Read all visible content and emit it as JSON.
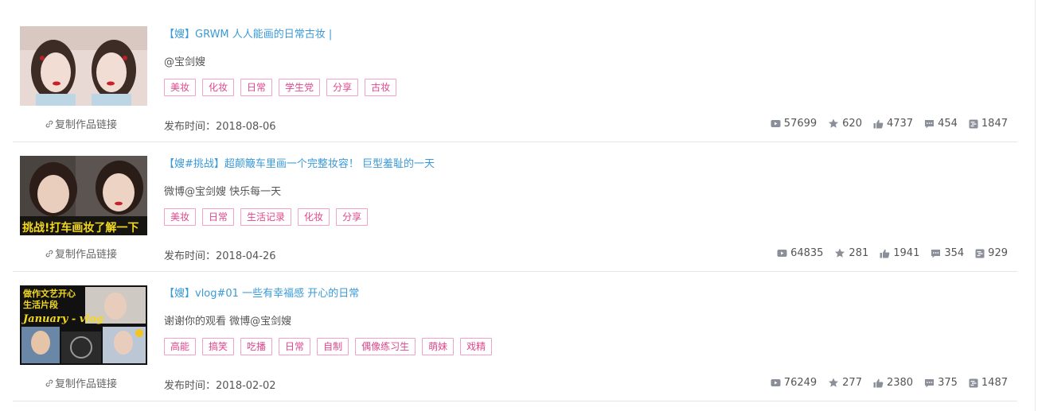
{
  "colors": {
    "title": "#3a9ad9",
    "tag_text": "#e0468c",
    "tag_border": "#f2a3c7",
    "icon": "#8a8f99"
  },
  "copy_link_label": "复制作品链接",
  "date_prefix": "发布时间：",
  "stat_icons": [
    "play-icon",
    "star-icon",
    "thumbs-up-icon",
    "comment-icon",
    "danmaku-icon"
  ],
  "videos": [
    {
      "title": "【嫂】GRWM 人人能画的日常古妆 |",
      "description": "@宝剑嫂",
      "tags": [
        "美妆",
        "化妆",
        "日常",
        "学生党",
        "分享",
        "古妆"
      ],
      "date": "2018-08-06",
      "stats": {
        "plays": "57699",
        "favorites": "620",
        "likes": "4737",
        "comments": "454",
        "danmaku": "1847"
      }
    },
    {
      "title": "【嫂#挑战】超颠簸车里画一个完整妆容！ 巨型羞耻的一天",
      "description": "微博@宝剑嫂 快乐每一天",
      "tags": [
        "美妆",
        "日常",
        "生活记录",
        "化妆",
        "分享"
      ],
      "thumb_caption": "挑战!打车画妆了解一下",
      "date": "2018-04-26",
      "stats": {
        "plays": "64835",
        "favorites": "281",
        "likes": "1941",
        "comments": "354",
        "danmaku": "929"
      }
    },
    {
      "title": "【嫂】vlog#01 一些有幸福感 开心的日常",
      "description": "谢谢你的观看 微博@宝剑嫂",
      "tags": [
        "高能",
        "搞笑",
        "吃播",
        "日常",
        "自制",
        "偶像练习生",
        "萌妹",
        "戏精"
      ],
      "thumb_caption_1": "做作文艺开心",
      "thumb_caption_2": "生活片段",
      "thumb_caption_3": "January - vlog",
      "date": "2018-02-02",
      "stats": {
        "plays": "76249",
        "favorites": "277",
        "likes": "2380",
        "comments": "375",
        "danmaku": "1487"
      }
    }
  ]
}
